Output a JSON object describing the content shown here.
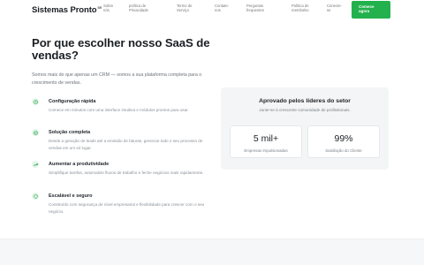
{
  "header": {
    "logo": "Sistemas Pronto",
    "logo_badge": "BR",
    "nav": [
      "Sobre\nnós",
      "política de\nPrivacidade",
      "Termo de\nServiço",
      "Contate-\nnos",
      "Perguntas\nfrequentes",
      "Política de\nreembolso",
      "Conecte-\nse"
    ],
    "cta": "Comece\nagora"
  },
  "section": {
    "title": "Por que escolher nosso SaaS de vendas?",
    "intro": "Somos mais do que apenas um CRM — somos a sua plataforma completa para o crescimento de vendas."
  },
  "features": [
    {
      "icon": "clock-icon",
      "title": "Configuração rápida",
      "desc": "Comece em minutos com uma interface intuitiva e módulos prontos para usar."
    },
    {
      "icon": "check-circle-icon",
      "title": "Solução completa",
      "desc": "Desde a geração de leads até a emissão de faturas, gerencie todo o seu processo de vendas em um só lugar."
    },
    {
      "icon": "trending-up-icon",
      "title": "Aumentar a produtividade",
      "desc": "Simplifique tarefas, automatize fluxos de trabalho e feche negócios mais rapidamente."
    },
    {
      "icon": "shield-icon",
      "title": "Escalável e seguro",
      "desc": "Construído com segurança de nível empresarial e flexibilidade para crescer com o seu negócio."
    }
  ],
  "card": {
    "title": "Aprovado pelos líderes do setor",
    "subtitle": "Junte-se à crescente comunidade de profissionais.",
    "stats": [
      {
        "value": "5 mil+",
        "label": "Empresas Impulsionadas"
      },
      {
        "value": "99%",
        "label": "Satisfação do Cliente"
      }
    ]
  },
  "colors": {
    "accent": "#22b14c",
    "icon_bg": "#e3f5e8",
    "card_bg": "#f3f5f6"
  }
}
